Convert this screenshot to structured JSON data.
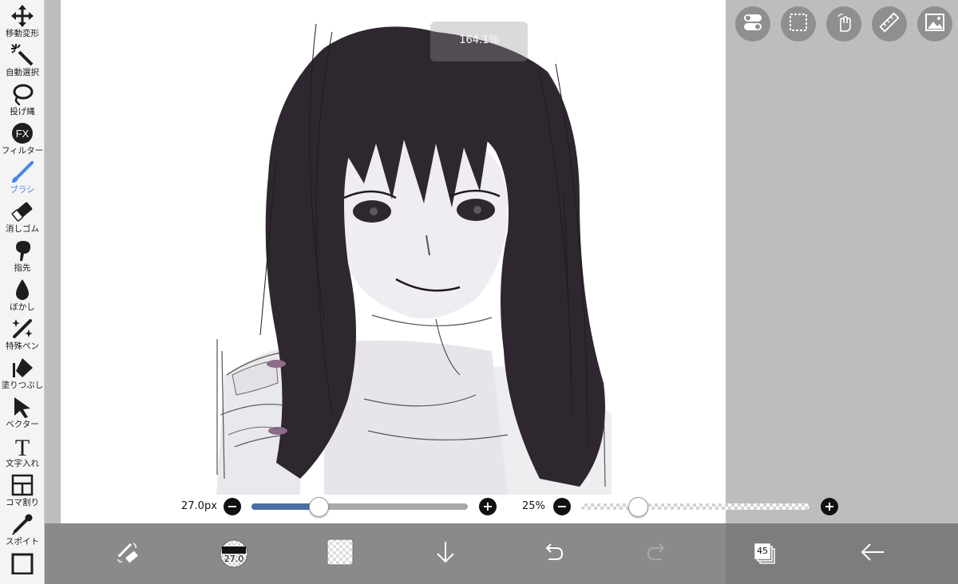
{
  "tools": [
    {
      "id": "move-transform",
      "label": "移動変形",
      "icon": "move-arrows-icon"
    },
    {
      "id": "auto-select",
      "label": "自動選択",
      "icon": "magic-wand-icon"
    },
    {
      "id": "lasso",
      "label": "投げ縄",
      "icon": "lasso-icon"
    },
    {
      "id": "filter",
      "label": "フィルター",
      "icon": "fx-icon"
    },
    {
      "id": "brush",
      "label": "ブラシ",
      "icon": "brush-icon",
      "active": true
    },
    {
      "id": "eraser",
      "label": "消しゴム",
      "icon": "eraser-icon"
    },
    {
      "id": "finger",
      "label": "指先",
      "icon": "finger-smudge-icon"
    },
    {
      "id": "blur",
      "label": "ぼかし",
      "icon": "blur-drop-icon"
    },
    {
      "id": "special-pen",
      "label": "特殊ペン",
      "icon": "sparkle-pen-icon"
    },
    {
      "id": "fill",
      "label": "塗りつぶし",
      "icon": "bucket-fill-icon"
    },
    {
      "id": "vector",
      "label": "ベクター",
      "icon": "vector-cursor-icon"
    },
    {
      "id": "text",
      "label": "文字入れ",
      "icon": "text-t-icon"
    },
    {
      "id": "frame-divider",
      "label": "コマ割り",
      "icon": "panel-divider-icon"
    },
    {
      "id": "eyedropper",
      "label": "スポイト",
      "icon": "eyedropper-icon"
    },
    {
      "id": "canvas-frame",
      "label": "",
      "icon": "frame-icon"
    }
  ],
  "canvas": {
    "zoom_label": "164.1%"
  },
  "top_buttons": [
    {
      "id": "toggle",
      "icon": "toggle-switch-icon"
    },
    {
      "id": "selection",
      "icon": "selection-rect-icon"
    },
    {
      "id": "gesture",
      "icon": "hand-gesture-icon"
    },
    {
      "id": "ruler",
      "icon": "ruler-pen-icon"
    },
    {
      "id": "material",
      "icon": "image-material-icon"
    }
  ],
  "brush_size": {
    "label": "27.0px",
    "minus": "−",
    "plus": "+",
    "level": 0.31
  },
  "brush_opacity": {
    "label": "25%",
    "minus": "−",
    "plus": "+",
    "level": 0.25
  },
  "bottom_bar": {
    "brush_preview_value": "27.0",
    "layers_count": "45",
    "items": [
      {
        "id": "swap",
        "icon": "swap-tools-icon"
      },
      {
        "id": "brush-size",
        "icon": "brush-size-icon"
      },
      {
        "id": "color",
        "icon": "color-swatch-icon"
      },
      {
        "id": "down",
        "icon": "arrow-down-icon"
      },
      {
        "id": "undo",
        "icon": "undo-icon"
      },
      {
        "id": "redo",
        "icon": "redo-icon"
      },
      {
        "id": "layers",
        "icon": "layers-icon"
      },
      {
        "id": "back",
        "icon": "arrow-left-icon"
      }
    ]
  },
  "colors": {
    "active_tool": "#4a86e8",
    "slider_fill": "#4a6fa5",
    "bottom_bar": "#8a8a8a",
    "hair": "#2f2730"
  }
}
